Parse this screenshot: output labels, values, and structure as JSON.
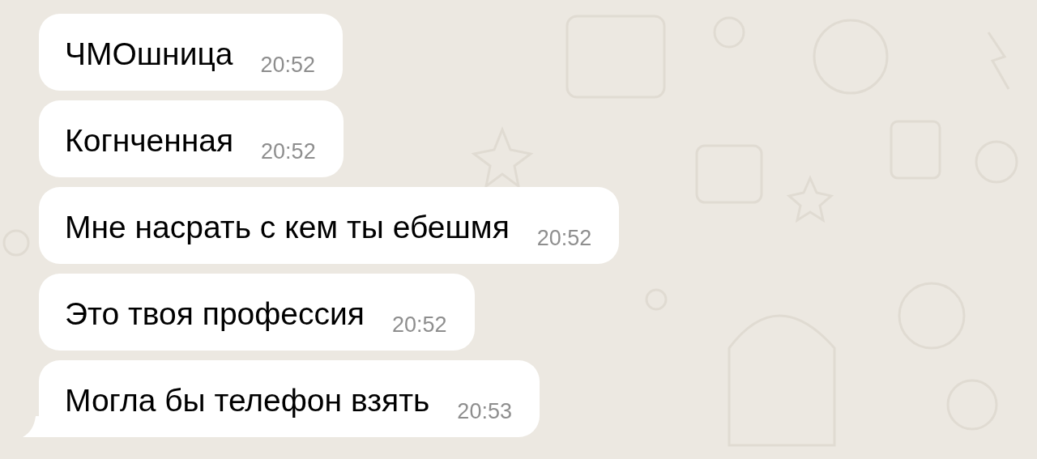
{
  "messages": [
    {
      "text": "ЧМОшница",
      "time": "20:52",
      "tail": false
    },
    {
      "text": "Когнченная",
      "time": "20:52",
      "tail": false
    },
    {
      "text": "Мне насрать с кем ты ебешмя",
      "time": "20:52",
      "tail": false
    },
    {
      "text": "Это твоя профессия",
      "time": "20:52",
      "tail": false
    },
    {
      "text": "Могла бы телефон взять",
      "time": "20:53",
      "tail": true
    }
  ]
}
